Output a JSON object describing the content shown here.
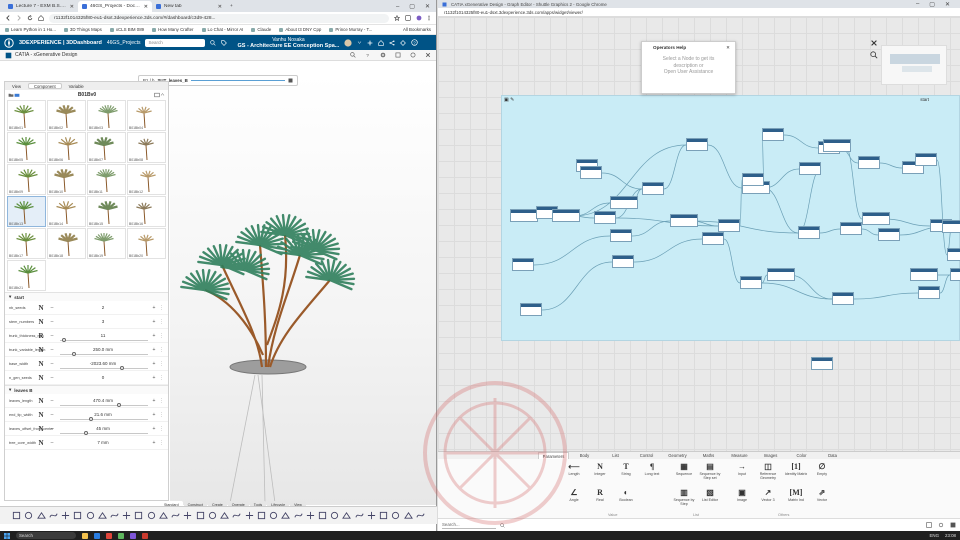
{
  "left_browser": {
    "tabs": [
      {
        "label": "Lecture 7 - EXM B.S. Wan Hu",
        "active": false
      },
      {
        "label": "46GS_Projects - Document, Hu",
        "active": true
      },
      {
        "label": "New tab",
        "active": false
      }
    ],
    "url": "r1132f1014325f80-eu1-dsxt.3dexperience.3ds.com/#/dashboard/c3d9-428...",
    "bookmarks": [
      "Learn Python in 1 Ho...",
      "3D Things Maps",
      "xCLS BIM 089",
      "How Many Crafter",
      "Lo Chat - Mirror AI",
      "Claude",
      "About I3 DNY Cpp",
      "Prince Murray - T..."
    ],
    "bookmarks_right": "All Bookmarks"
  },
  "app_bar": {
    "brand": "3DEXPERIENCE | 3DDashboard",
    "dashboard": "46GS_Projects",
    "search_placeholder": "Search",
    "project_name": "Vanhu Nosaka",
    "project_subtitle": "GS - Architecture EE Conception Spa..."
  },
  "sub_bar": {
    "title": "CATIA - xGenerative Design"
  },
  "panel": {
    "tabs": [
      {
        "label": "View",
        "active": false
      },
      {
        "label": "Component",
        "active": true
      },
      {
        "label": "Variable",
        "active": false
      }
    ],
    "title": "B01Bv0",
    "thumbnails": [
      {
        "label": "B01Bb01",
        "selected": false,
        "kind": "a"
      },
      {
        "label": "B01Bb02",
        "selected": false,
        "kind": "b"
      },
      {
        "label": "B01Bb03",
        "selected": false,
        "kind": "c"
      },
      {
        "label": "B01Bb04",
        "selected": false,
        "kind": "d"
      },
      {
        "label": "B01Bb05",
        "selected": false,
        "kind": "e"
      },
      {
        "label": "B01Bb06",
        "selected": false,
        "kind": "f"
      },
      {
        "label": "B01Bb07",
        "selected": false,
        "kind": "g"
      },
      {
        "label": "B01Bb08",
        "selected": false,
        "kind": "h"
      },
      {
        "label": "B01Bb09",
        "selected": false,
        "kind": "i"
      },
      {
        "label": "B01Bb10",
        "selected": false,
        "kind": "j"
      },
      {
        "label": "B01Bb11",
        "selected": false,
        "kind": "k"
      },
      {
        "label": "B01Bb12",
        "selected": false,
        "kind": "l"
      },
      {
        "label": "B01Bb13",
        "selected": true,
        "kind": "m"
      },
      {
        "label": "B01Bb14",
        "selected": false,
        "kind": "n"
      },
      {
        "label": "B01Bb15",
        "selected": false,
        "kind": "o"
      },
      {
        "label": "B01Bb16",
        "selected": false,
        "kind": "p"
      },
      {
        "label": "B01Bb17",
        "selected": false,
        "kind": "q"
      },
      {
        "label": "B01Bb18",
        "selected": false,
        "kind": "r"
      },
      {
        "label": "B01Bb19",
        "selected": false,
        "kind": "s"
      },
      {
        "label": "B01Bb20",
        "selected": false,
        "kind": "t"
      },
      {
        "label": "B01Bb21",
        "selected": false,
        "kind": "u"
      }
    ],
    "section_start": "start",
    "params_start": [
      {
        "name": "nb_seeds",
        "type": "N",
        "value": "2",
        "slider": null
      },
      {
        "name": "stem_numbers",
        "type": "N",
        "value": "3",
        "slider": null
      },
      {
        "name": "trunk_thickness_min",
        "type": "R",
        "value": "11",
        "slider": 0.05
      },
      {
        "name": "trunk_variable_length",
        "type": "N",
        "value": "250.0 mm",
        "slider": 0.16
      },
      {
        "name": "base_width",
        "type": "N",
        "value": "-2023.60 mm",
        "slider": 0.7
      },
      {
        "name": "n_gen_seeds",
        "type": "N",
        "value": "0",
        "slider": null
      }
    ],
    "section_leaves": "leaves B",
    "params_leaves": [
      {
        "name": "leaves_length",
        "type": "N",
        "value": "470.4 mm",
        "slider": 0.67
      },
      {
        "name": "end_tip_width",
        "type": "N",
        "value": "21.6 mm",
        "slider": 0.35
      },
      {
        "name": "leaves_offset_from_center",
        "type": "N",
        "value": "45 mm",
        "slider": 0.3
      },
      {
        "name": "tree_core_width",
        "type": "N",
        "value": "7 mm",
        "slider": null
      }
    ]
  },
  "viewport": {
    "operator_label": "SUT_leaves_B",
    "operator_prefix": "B1 / b"
  },
  "bottom_tabs": [
    {
      "label": "Standard",
      "active": true
    },
    {
      "label": "Construct",
      "active": false
    },
    {
      "label": "Create",
      "active": false
    },
    {
      "label": "Operate",
      "active": false
    },
    {
      "label": "Tools",
      "active": false
    },
    {
      "label": "Lifecycle",
      "active": false
    },
    {
      "label": "View",
      "active": false
    }
  ],
  "right_window": {
    "title": "CATIA xGenerative Design - Graph Editor - Shuttle Graphics 2 - Google Chrome",
    "url": "r1132f1014325f80-eu1-dsxt.3dexperience.3ds.com/apps/widget/viewer/",
    "help_title": "Operators Help",
    "help_body": [
      "Select a Node to get its",
      "description or",
      "Open User Assistance"
    ],
    "canvas_label": "start",
    "ops_tabs": [
      {
        "label": "Parameters",
        "active": true
      },
      {
        "label": "Body",
        "active": false
      },
      {
        "label": "List",
        "active": false
      },
      {
        "label": "Control",
        "active": false
      },
      {
        "label": "Geometry",
        "active": false
      },
      {
        "label": "Maths",
        "active": false
      },
      {
        "label": "Measure",
        "active": false
      },
      {
        "label": "Images",
        "active": false
      },
      {
        "label": "Color",
        "active": false
      },
      {
        "label": "Data",
        "active": false
      }
    ],
    "operators": [
      {
        "label": "Length",
        "glyph": "⟵"
      },
      {
        "label": "Integer",
        "glyph": "N"
      },
      {
        "label": "String",
        "glyph": "T"
      },
      {
        "label": "Long text",
        "glyph": "¶"
      },
      {
        "label": "Sequence",
        "glyph": "▦"
      },
      {
        "label": "Sequence by Step set",
        "glyph": "▤"
      },
      {
        "label": "Input",
        "glyph": "→"
      },
      {
        "label": "Reference Geometry",
        "glyph": "◫"
      },
      {
        "label": "Identity Matrix",
        "glyph": "[1]"
      },
      {
        "label": "Empty",
        "glyph": "∅"
      },
      {
        "label": "Angle",
        "glyph": "∠"
      },
      {
        "label": "Real",
        "glyph": "R"
      },
      {
        "label": "Boolean",
        "glyph": "◐"
      },
      {
        "label": "Sequence by Step",
        "glyph": "▥"
      },
      {
        "label": "List Editor",
        "glyph": "▧"
      },
      {
        "label": "Image",
        "glyph": "▣"
      },
      {
        "label": "Vector 3",
        "glyph": "↗"
      },
      {
        "label": "Matrix Ind",
        "glyph": "[M]"
      },
      {
        "label": "Vector",
        "glyph": "⇗"
      }
    ],
    "categories": [
      "Value",
      "List",
      "Others"
    ],
    "search_placeholder": "Search..."
  },
  "taskbar": {
    "search": "Search",
    "time": "23:08",
    "lang": "ENG"
  }
}
